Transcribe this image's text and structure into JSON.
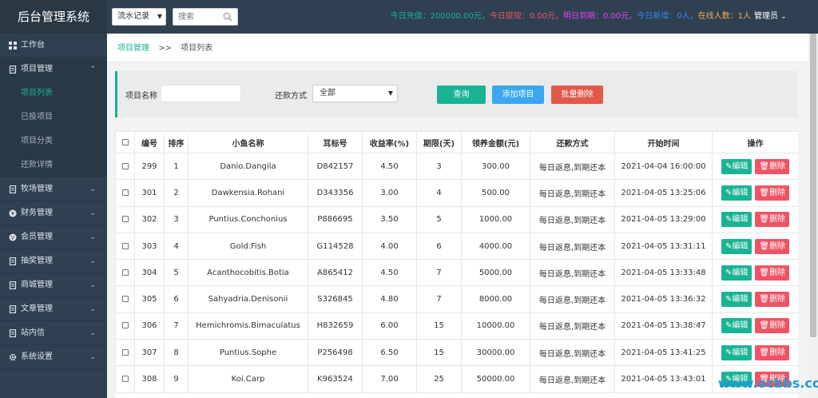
{
  "header": {
    "brand": "后台管理系统",
    "search_select": "流水记录",
    "search_placeholder": "搜索",
    "stats": [
      {
        "text": "今日充值：200000.00元，",
        "color": "#1ab394"
      },
      {
        "text": "今日提现：0.00元，",
        "color": "#ed5565"
      },
      {
        "text": "明日到期：0.00元，",
        "color": "#e040fb"
      },
      {
        "text": "今日新增：0人，",
        "color": "#3b82f6"
      },
      {
        "text": "在线人数：1人",
        "color": "#f8ac59"
      }
    ],
    "admin_label": "管理员"
  },
  "sidebar": {
    "items": [
      {
        "label": "工作台",
        "icon": "dashboard-icon",
        "expandable": false
      },
      {
        "label": "项目管理",
        "icon": "file-icon",
        "expandable": true,
        "open": true,
        "children": [
          {
            "label": "项目列表",
            "active": true
          },
          {
            "label": "已投项目"
          },
          {
            "label": "项目分类"
          },
          {
            "label": "还款详情"
          }
        ]
      },
      {
        "label": "牧场管理",
        "icon": "file-icon",
        "expandable": true
      },
      {
        "label": "财务管理",
        "icon": "gift-icon",
        "expandable": true
      },
      {
        "label": "会员管理",
        "icon": "user-icon",
        "expandable": true
      },
      {
        "label": "抽奖管理",
        "icon": "file-icon",
        "expandable": true
      },
      {
        "label": "商城管理",
        "icon": "file-icon",
        "expandable": true
      },
      {
        "label": "文章管理",
        "icon": "file-icon",
        "expandable": true
      },
      {
        "label": "站内信",
        "icon": "file-icon",
        "expandable": true
      },
      {
        "label": "系统设置",
        "icon": "gear-icon",
        "expandable": true
      }
    ]
  },
  "breadcrumb": {
    "home": "项目管理",
    "sep": ">>",
    "current": "项目列表"
  },
  "filter": {
    "name_label": "项目名称",
    "name_value": "",
    "repay_label": "还款方式",
    "repay_selected": "全部",
    "query_label": "查询",
    "add_label": "添加项目",
    "batch_delete_label": "批量删除"
  },
  "table": {
    "headers": [
      "编号",
      "排序",
      "小鱼名称",
      "耳标号",
      "收益率(%)",
      "期限(天)",
      "领养金额(元)",
      "还款方式",
      "开始时间",
      "操作"
    ],
    "edit_label": "编辑",
    "delete_label": "删除",
    "rows": [
      [
        "299",
        "1",
        "Danio.Dangila",
        "D842157",
        "4.50",
        "3",
        "300.00",
        "每日返息,到期还本",
        "2021-04-04 16:00:00"
      ],
      [
        "301",
        "2",
        "Dawkensia.Rohani",
        "D343356",
        "3.00",
        "4",
        "500.00",
        "每日返息,到期还本",
        "2021-04-05 13:25:06"
      ],
      [
        "302",
        "3",
        "Puntius.Conchonius",
        "P886695",
        "3.50",
        "5",
        "1000.00",
        "每日返息,到期还本",
        "2021-04-05 13:29:00"
      ],
      [
        "303",
        "4",
        "Gold.Fish",
        "G114528",
        "4.00",
        "6",
        "4000.00",
        "每日返息,到期还本",
        "2021-04-05 13:31:11"
      ],
      [
        "304",
        "5",
        "Acanthocobitis.Botia",
        "A865412",
        "4.50",
        "7",
        "5000.00",
        "每日返息,到期还本",
        "2021-04-05 13:33:48"
      ],
      [
        "305",
        "6",
        "Sahyadria.Denisonii",
        "S326845",
        "4.80",
        "7",
        "8000.00",
        "每日返息,到期还本",
        "2021-04-05 13:36:32"
      ],
      [
        "306",
        "7",
        "Hemichromis.Bimaculatus",
        "H832659",
        "6.00",
        "15",
        "10000.00",
        "每日返息,到期还本",
        "2021-04-05 13:38:47"
      ],
      [
        "307",
        "8",
        "Puntius.Sophe",
        "P256498",
        "6.50",
        "15",
        "30000.00",
        "每日返息,到期还本",
        "2021-04-05 13:41:25"
      ],
      [
        "308",
        "9",
        "Koi.Carp",
        "K963524",
        "7.00",
        "25",
        "50000.00",
        "每日返息,到期还本",
        "2021-04-05 13:43:01"
      ]
    ]
  },
  "watermark": "www.ocbbs.com"
}
